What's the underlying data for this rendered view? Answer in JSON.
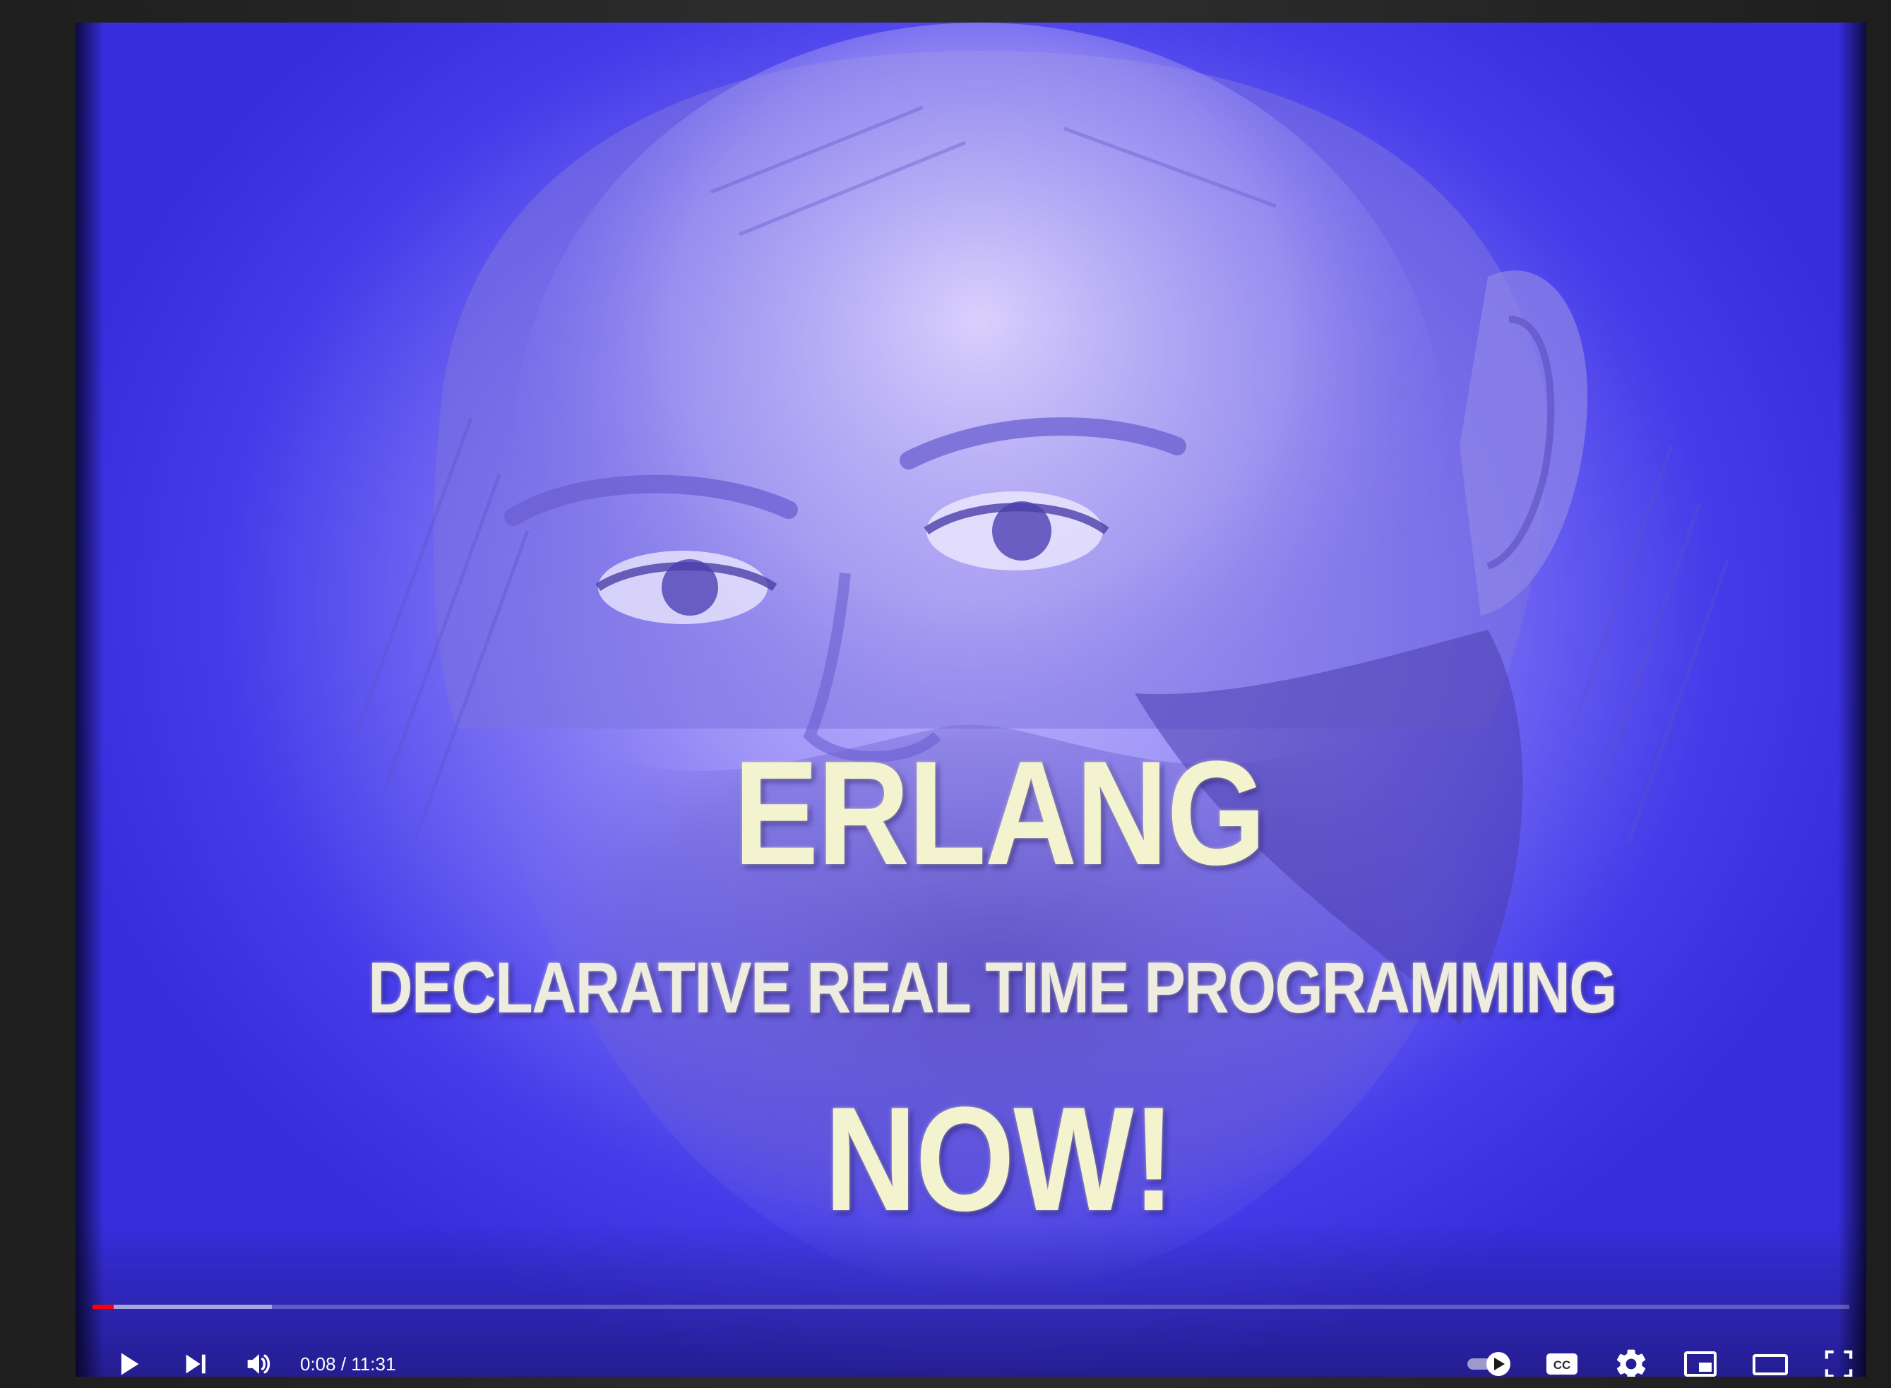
{
  "video": {
    "title_main": "ERLANG",
    "title_sub": "DECLARATIVE REAL TIME PROGRAMMING",
    "title_now": "NOW!"
  },
  "player": {
    "time_current": "0:08",
    "time_separator": " / ",
    "time_total": "11:31",
    "progress_played_fraction": 0.012,
    "progress_buffered_fraction": 0.102,
    "autoplay_on": true,
    "icons": {
      "play": "play-icon",
      "next": "next-icon",
      "volume": "volume-icon",
      "autoplay": "autoplay-toggle-icon",
      "captions": "captions-icon",
      "settings": "gear-icon",
      "miniplayer": "miniplayer-icon",
      "theater": "theater-mode-icon",
      "fullscreen": "fullscreen-icon"
    },
    "accent_color": "#ff0000"
  }
}
